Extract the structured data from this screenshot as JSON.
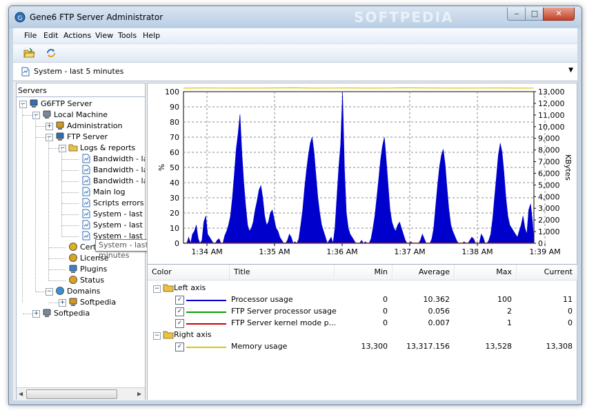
{
  "window": {
    "title": "Gene6 FTP Server Administrator",
    "watermark": "SOFTPEDIA",
    "controls": {
      "minimize": "‒",
      "maximize": "□",
      "close": "✕"
    }
  },
  "menu": [
    "File",
    "Edit",
    "Actions",
    "View",
    "Tools",
    "Help"
  ],
  "toolbar": {
    "icons": [
      "folder-open-icon",
      "refresh-icon"
    ]
  },
  "selector": {
    "value": "System - last 5 minutes"
  },
  "servers_panel": {
    "title": "Servers",
    "tree": [
      {
        "label": "G6FTP Server",
        "icon": "server-icon",
        "level": 0,
        "expander": "−"
      },
      {
        "label": "Local Machine",
        "icon": "computer-icon",
        "level": 1,
        "expander": "−"
      },
      {
        "label": "Administration",
        "icon": "admin-icon",
        "level": 2,
        "expander": "+"
      },
      {
        "label": "FTP Server",
        "icon": "ftp-server-icon",
        "level": 2,
        "expander": "−"
      },
      {
        "label": "Logs & reports",
        "icon": "folder-icon",
        "level": 3,
        "expander": "−"
      },
      {
        "label": "Bandwidth - la",
        "icon": "report-icon",
        "level": 4
      },
      {
        "label": "Bandwidth - la",
        "icon": "report-icon",
        "level": 4
      },
      {
        "label": "Bandwidth - la",
        "icon": "report-icon",
        "level": 4
      },
      {
        "label": "Main log",
        "icon": "log-icon",
        "level": 4
      },
      {
        "label": "Scripts errors",
        "icon": "log-icon",
        "level": 4
      },
      {
        "label": "System - last",
        "icon": "report-icon",
        "level": 4
      },
      {
        "label": "System - last 5 minutes",
        "icon": "report-icon",
        "level": 4,
        "tooltip": true
      },
      {
        "label": "System - last",
        "icon": "report-icon",
        "level": 4
      },
      {
        "label": "Certificates",
        "icon": "certificate-icon",
        "level": 3
      },
      {
        "label": "License",
        "icon": "license-icon",
        "level": 3
      },
      {
        "label": "Plugins",
        "icon": "plugin-icon",
        "level": 3
      },
      {
        "label": "Status",
        "icon": "status-icon",
        "level": 3
      },
      {
        "label": "Domains",
        "icon": "globe-icon",
        "level": 2,
        "expander": "−"
      },
      {
        "label": "Softpedia",
        "icon": "domain-icon",
        "level": 3,
        "expander": "+"
      },
      {
        "label": "Softpedia",
        "icon": "computer-icon",
        "level": 1,
        "expander": "+"
      }
    ]
  },
  "chart_data": {
    "type": "area",
    "left_axis": {
      "label": "%",
      "ticks": [
        0,
        10,
        20,
        30,
        40,
        50,
        60,
        70,
        80,
        90,
        100
      ],
      "range": [
        0,
        100
      ]
    },
    "right_axis": {
      "label": "KBytes",
      "ticks": [
        "0",
        "1,000",
        "2,000",
        "3,000",
        "4,000",
        "5,000",
        "6,000",
        "7,000",
        "8,000",
        "9,000",
        "10,000",
        "11,000",
        "12,000",
        "13,000"
      ],
      "range": [
        0,
        13000
      ]
    },
    "x_ticks": [
      "1:34 AM",
      "1:35 AM",
      "1:36 AM",
      "1:37 AM",
      "1:38 AM",
      "1:39 AM"
    ],
    "grid": true,
    "series": [
      {
        "name": "Processor usage",
        "color": "#0000cc",
        "values": [
          0,
          0,
          4,
          0,
          6,
          8,
          12,
          3,
          0,
          2,
          14,
          18,
          6,
          4,
          2,
          0,
          0,
          2,
          3,
          0,
          0,
          5,
          8,
          12,
          18,
          30,
          45,
          62,
          72,
          85,
          60,
          40,
          25,
          12,
          8,
          10,
          14,
          22,
          28,
          35,
          38,
          30,
          18,
          12,
          14,
          20,
          22,
          16,
          10,
          8,
          4,
          2,
          0,
          0,
          2,
          6,
          4,
          0,
          1,
          0,
          3,
          12,
          22,
          36,
          48,
          58,
          66,
          70,
          60,
          45,
          30,
          20,
          12,
          8,
          4,
          0,
          2,
          4,
          0,
          10,
          30,
          50,
          65,
          100,
          50,
          20,
          10,
          6,
          4,
          2,
          0,
          0,
          0,
          2,
          0,
          1,
          0,
          0,
          3,
          10,
          18,
          30,
          42,
          55,
          64,
          70,
          55,
          38,
          22,
          14,
          10,
          8,
          12,
          14,
          10,
          6,
          2,
          0,
          0,
          1,
          0,
          0,
          0,
          0,
          2,
          6,
          3,
          0,
          0,
          0,
          3,
          10,
          24,
          38,
          50,
          58,
          62,
          52,
          36,
          22,
          12,
          8,
          5,
          2,
          0,
          0,
          0,
          1,
          0,
          0,
          2,
          4,
          3,
          0,
          0,
          0,
          6,
          4,
          0,
          0,
          2,
          6,
          16,
          30,
          44,
          58,
          66,
          60,
          46,
          30,
          18,
          12,
          10,
          8,
          6,
          4,
          8,
          12,
          18,
          10,
          6,
          22,
          26,
          14
        ]
      },
      {
        "name": "FTP Server processor usage",
        "color": "#00a000",
        "values": [
          0,
          0,
          0,
          0,
          0,
          0,
          0,
          0,
          0,
          0
        ]
      },
      {
        "name": "FTP Server kernel mode p...",
        "color": "#cc0000",
        "values": [
          0,
          0,
          0,
          0,
          0,
          0,
          0,
          0,
          0,
          0
        ]
      },
      {
        "name": "Memory usage",
        "color": "#d8c800",
        "axis": "right",
        "values": [
          13300,
          13320,
          13310,
          13300,
          13310,
          13320,
          13330,
          13300,
          13310,
          13320,
          13300,
          13310,
          13330,
          13320,
          13310,
          13300,
          13310,
          13320,
          13300,
          13310
        ]
      }
    ]
  },
  "table": {
    "headers": [
      "Color",
      "Title",
      "Min",
      "Average",
      "Max",
      "Current"
    ],
    "groups": [
      {
        "label": "Left axis",
        "expander": "−",
        "rows": [
          {
            "title": "Processor usage",
            "color": "#0000cc",
            "min": "0",
            "avg": "10.362",
            "max": "100",
            "current": "11"
          },
          {
            "title": "FTP Server processor usage",
            "color": "#00a000",
            "min": "0",
            "avg": "0.056",
            "max": "2",
            "current": "0"
          },
          {
            "title": "FTP Server kernel mode p...",
            "color": "#cc0000",
            "min": "0",
            "avg": "0.007",
            "max": "1",
            "current": "0"
          }
        ]
      },
      {
        "label": "Right axis",
        "expander": "−",
        "rows": [
          {
            "title": "Memory usage",
            "color": "#d8c800",
            "min": "13,300",
            "avg": "13,317.156",
            "max": "13,528",
            "current": "13,308"
          }
        ]
      }
    ],
    "check_mark": "✓"
  }
}
